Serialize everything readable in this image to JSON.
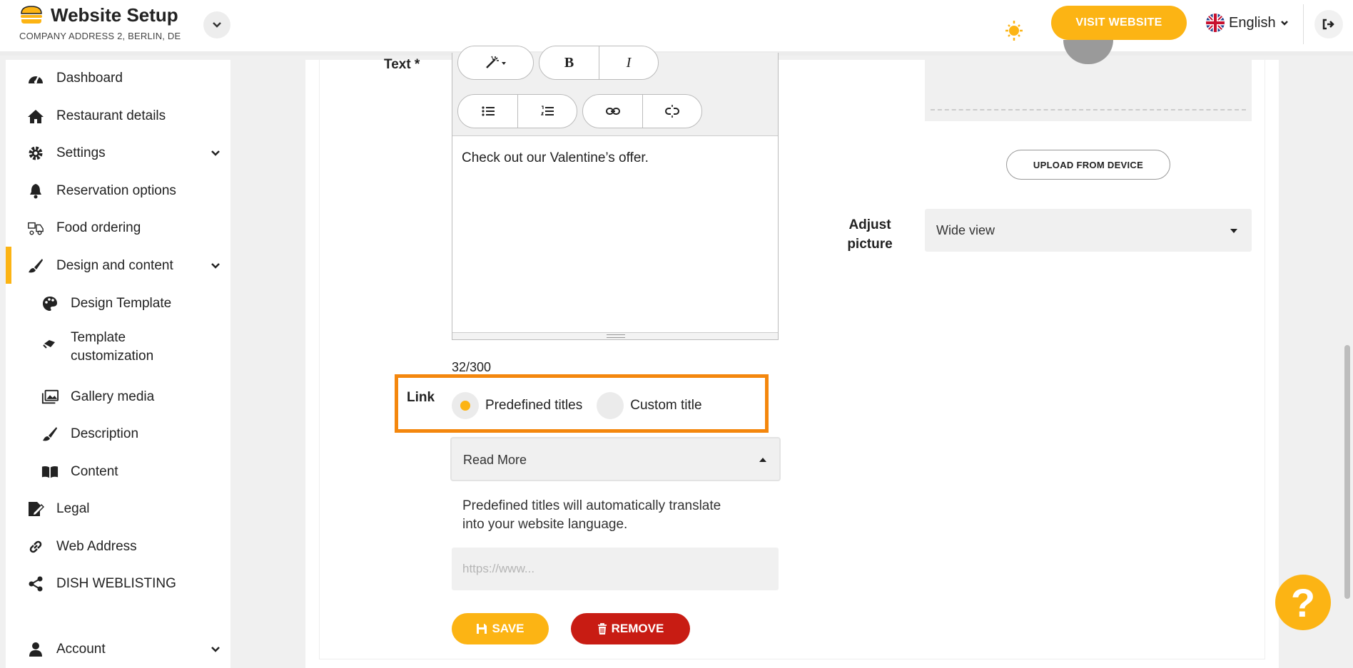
{
  "header": {
    "title": "Website Setup",
    "subtitle": "COMPANY ADDRESS 2, BERLIN, DE",
    "visit_label": "VISIT WEBSITE",
    "language": "English"
  },
  "sidebar": {
    "items": [
      {
        "label": "Dashboard",
        "icon": "dashboard-icon"
      },
      {
        "label": "Restaurant details",
        "icon": "home-icon"
      },
      {
        "label": "Settings",
        "icon": "gear-icon"
      },
      {
        "label": "Reservation options",
        "icon": "bell-icon"
      },
      {
        "label": "Food ordering",
        "icon": "food-ordering-icon"
      },
      {
        "label": "Design and content",
        "icon": "brush-icon"
      },
      {
        "label": "Design Template",
        "icon": "palette-icon"
      },
      {
        "label": "Template",
        "label2": "customization",
        "icon": "customization-icon"
      },
      {
        "label": "Gallery media",
        "icon": "gallery-icon"
      },
      {
        "label": "Description",
        "icon": "brush-icon"
      },
      {
        "label": "Content",
        "icon": "book-icon"
      },
      {
        "label": "Legal",
        "icon": "legal-icon"
      },
      {
        "label": "Web Address",
        "icon": "link-icon"
      },
      {
        "label": "DISH WEBLISTING",
        "icon": "share-icon"
      },
      {
        "label": "Account",
        "icon": "user-icon"
      }
    ]
  },
  "form": {
    "text_label": "Text *",
    "editor_text": "Check out our Valentine’s offer.",
    "counter": "32/300",
    "link_label": "Link",
    "radio_predefined": "Predefined titles",
    "radio_custom": "Custom title",
    "selected_option": "Read More",
    "help_line1": "Predefined titles will automatically translate",
    "help_line2": "into your website language.",
    "url_placeholder": "https://www...",
    "save_label": "SAVE",
    "remove_label": "REMOVE"
  },
  "image": {
    "upload_label": "UPLOAD FROM DEVICE",
    "adjust_label_1": "Adjust",
    "adjust_label_2": "picture",
    "adjust_value": "Wide view"
  },
  "colors": {
    "accent": "#fcb414",
    "danger": "#c81c13",
    "highlight": "#f4870d"
  }
}
